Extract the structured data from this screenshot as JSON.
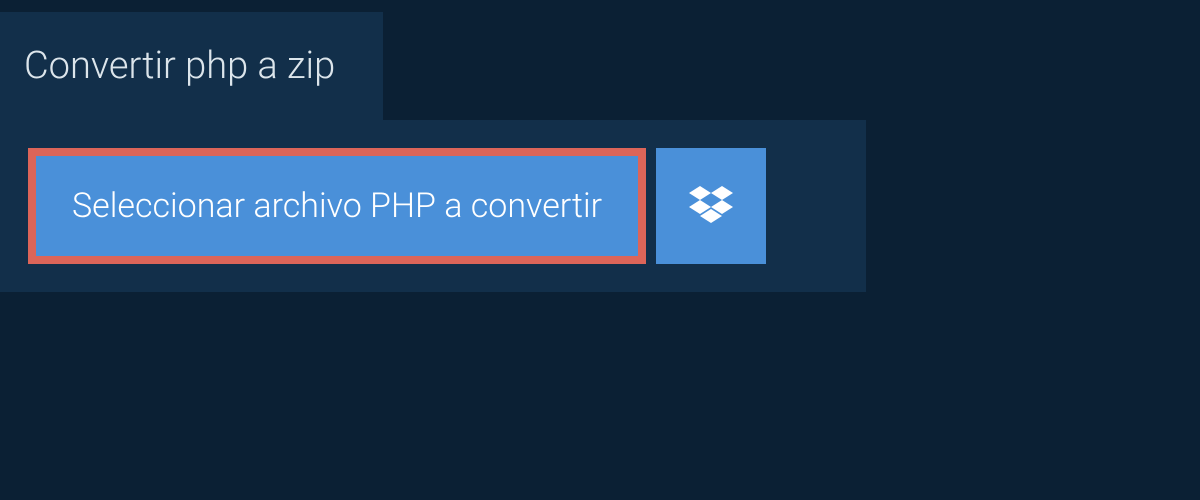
{
  "header": {
    "title": "Convertir php a zip"
  },
  "main": {
    "select_button_label": "Seleccionar archivo PHP a convertir"
  }
}
